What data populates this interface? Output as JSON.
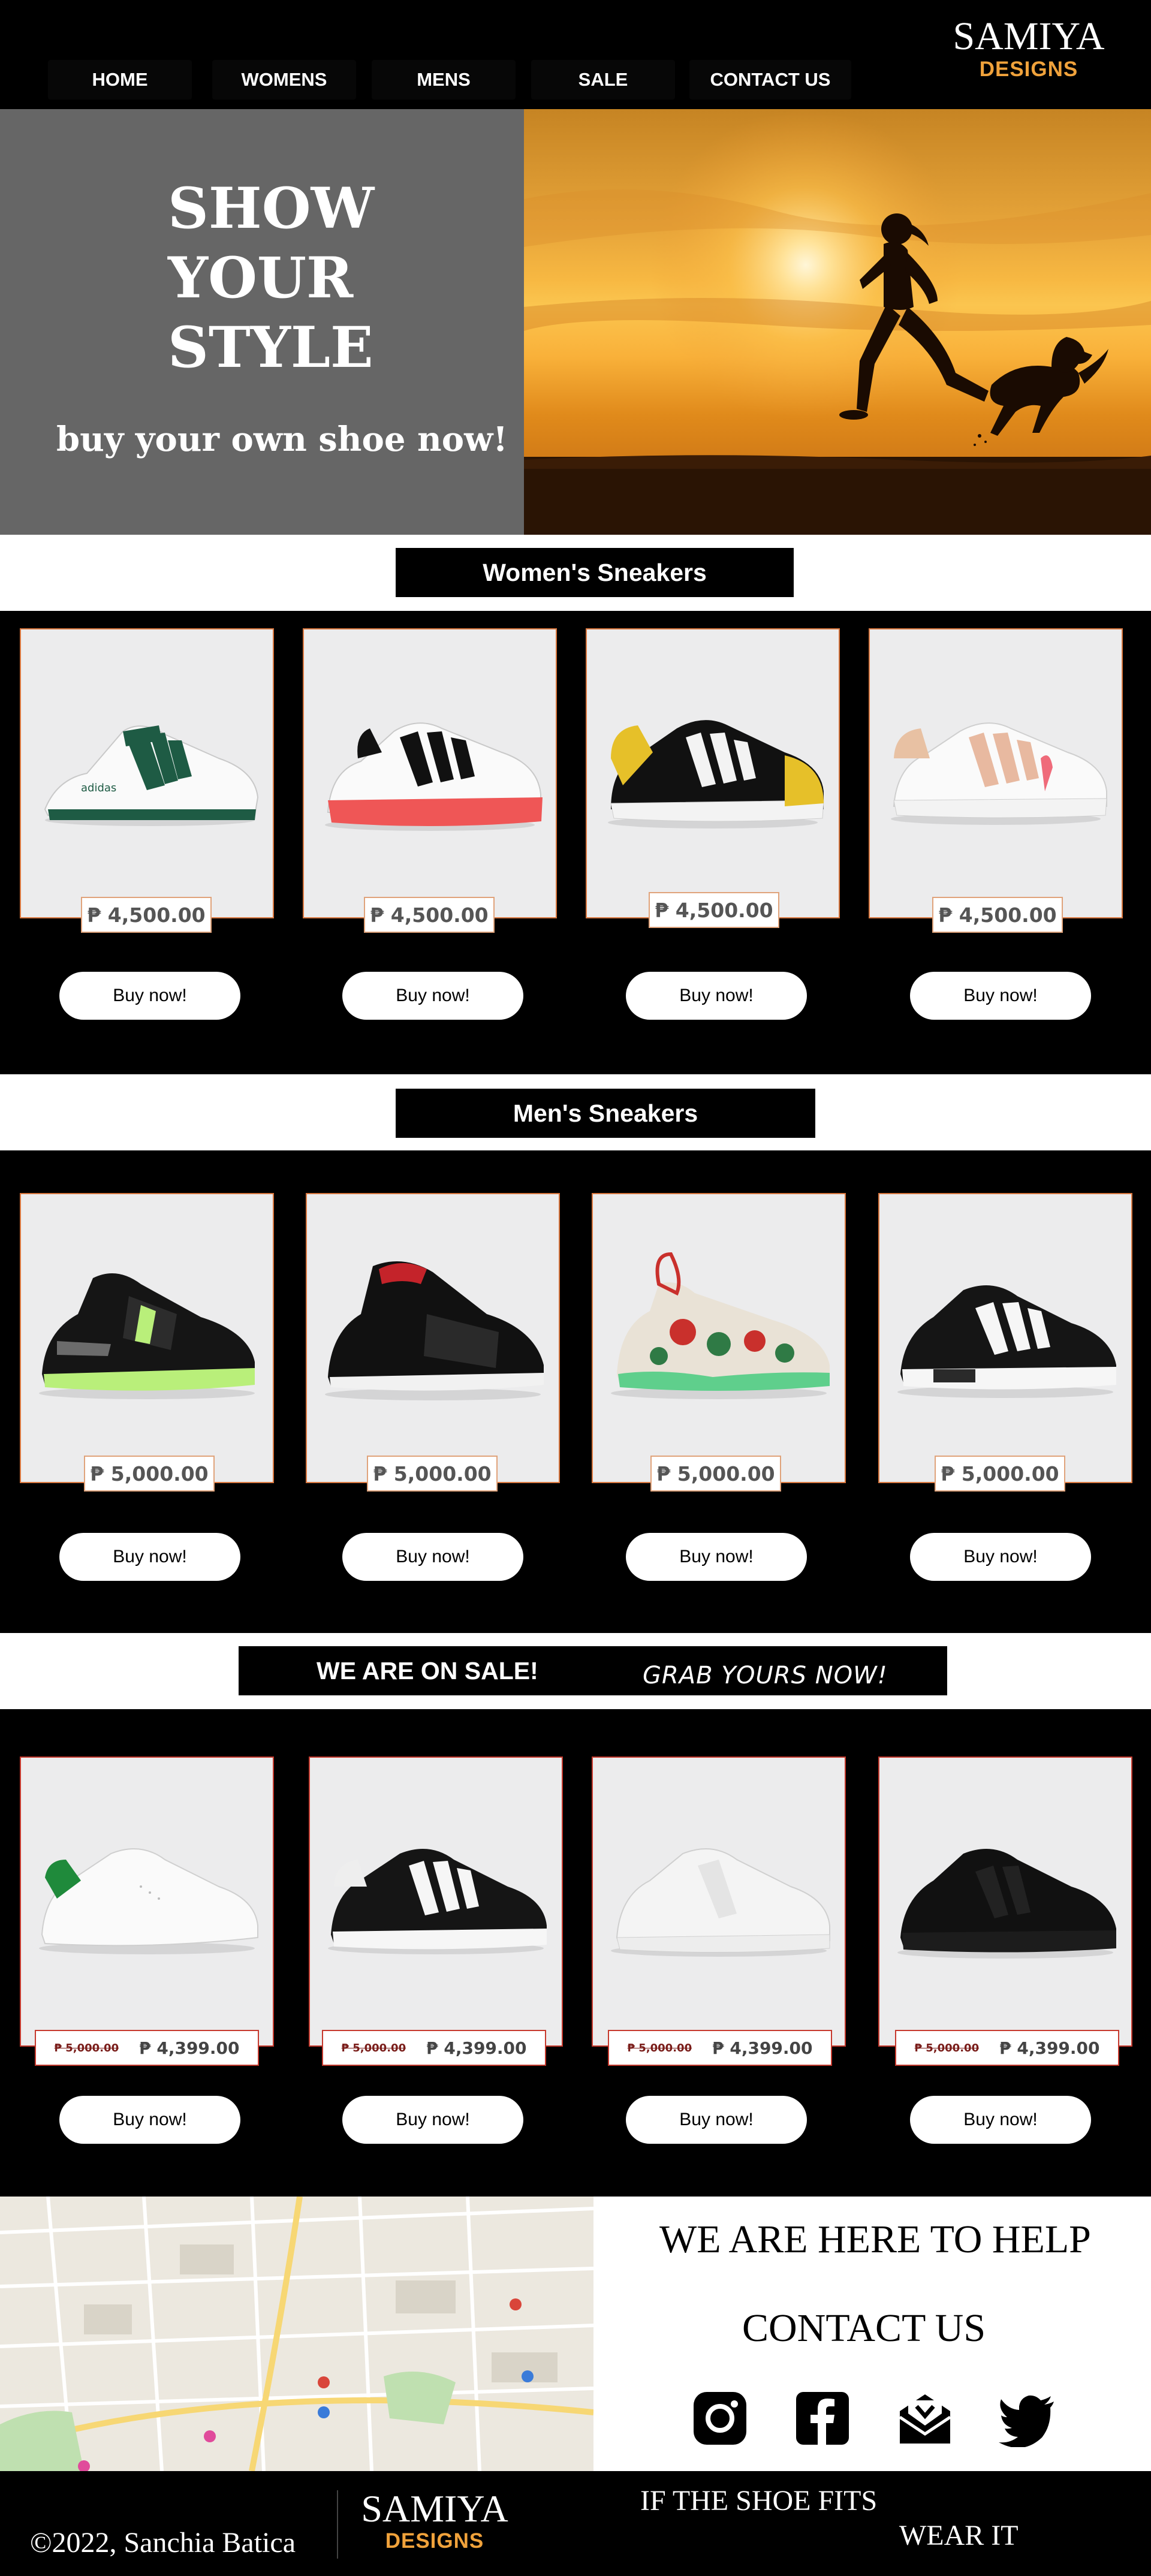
{
  "header": {
    "nav": [
      "HOME",
      "WOMENS",
      "MENS",
      "SALE",
      "CONTACT US"
    ],
    "brand_name": "SAMIYA",
    "brand_sub": "DESIGNS"
  },
  "hero": {
    "headline": [
      "SHOW",
      "YOUR",
      "STYLE"
    ],
    "subheadline": "buy your own shoe now!"
  },
  "womens": {
    "title": "Women's Sneakers",
    "products": [
      {
        "price": "₱ 4,500.00",
        "button": "Buy now!",
        "accent": "#1e5b44"
      },
      {
        "price": "₱ 4,500.00",
        "button": "Buy now!",
        "accent": "#ef5656"
      },
      {
        "price": "₱ 4,500.00",
        "button": "Buy now!",
        "accent": "#e6c029"
      },
      {
        "price": "₱ 4,500.00",
        "button": "Buy now!",
        "accent": "#e8b9a0"
      }
    ]
  },
  "mens": {
    "title": "Men's Sneakers",
    "products": [
      {
        "price": "₱ 5,000.00",
        "button": "Buy now!",
        "accent": "#b9ef7a"
      },
      {
        "price": "₱ 5,000.00",
        "button": "Buy now!",
        "accent": "#c4232a"
      },
      {
        "price": "₱ 5,000.00",
        "button": "Buy now!",
        "accent": "#5fcf8c"
      },
      {
        "price": "₱ 5,000.00",
        "button": "Buy now!",
        "accent": "#ffffff"
      }
    ]
  },
  "sale": {
    "title": "WE ARE ON SALE!",
    "subtitle": "GRAB YOURS NOW!",
    "products": [
      {
        "old_price": "₱ 5,000.00",
        "price": "₱ 4,399.00",
        "button": "Buy now!",
        "accent": "#1f8a3b"
      },
      {
        "old_price": "₱ 5,000.00",
        "price": "₱ 4,399.00",
        "button": "Buy now!",
        "accent": "#ffffff"
      },
      {
        "old_price": "₱ 5,000.00",
        "price": "₱ 4,399.00",
        "button": "Buy now!",
        "accent": "#f2f2f2"
      },
      {
        "old_price": "₱ 5,000.00",
        "price": "₱ 4,399.00",
        "button": "Buy now!",
        "accent": "#111111"
      }
    ]
  },
  "contact": {
    "help": "WE ARE HERE TO HELP",
    "title": "CONTACT US",
    "socials": [
      "instagram-icon",
      "facebook-icon",
      "mail-icon",
      "twitter-icon"
    ]
  },
  "footer": {
    "copyright": "©2022, Sanchia Batica",
    "brand_name": "SAMIYA",
    "brand_sub": "DESIGNS",
    "tagline_1": "IF THE SHOE FITS",
    "tagline_2": "WEAR IT"
  },
  "colors": {
    "accent": "#f0a23b",
    "hero_panel": "#666666",
    "card_bg": "#ececed",
    "card_border": "#d9773f",
    "sale_border": "#c63a2e"
  }
}
